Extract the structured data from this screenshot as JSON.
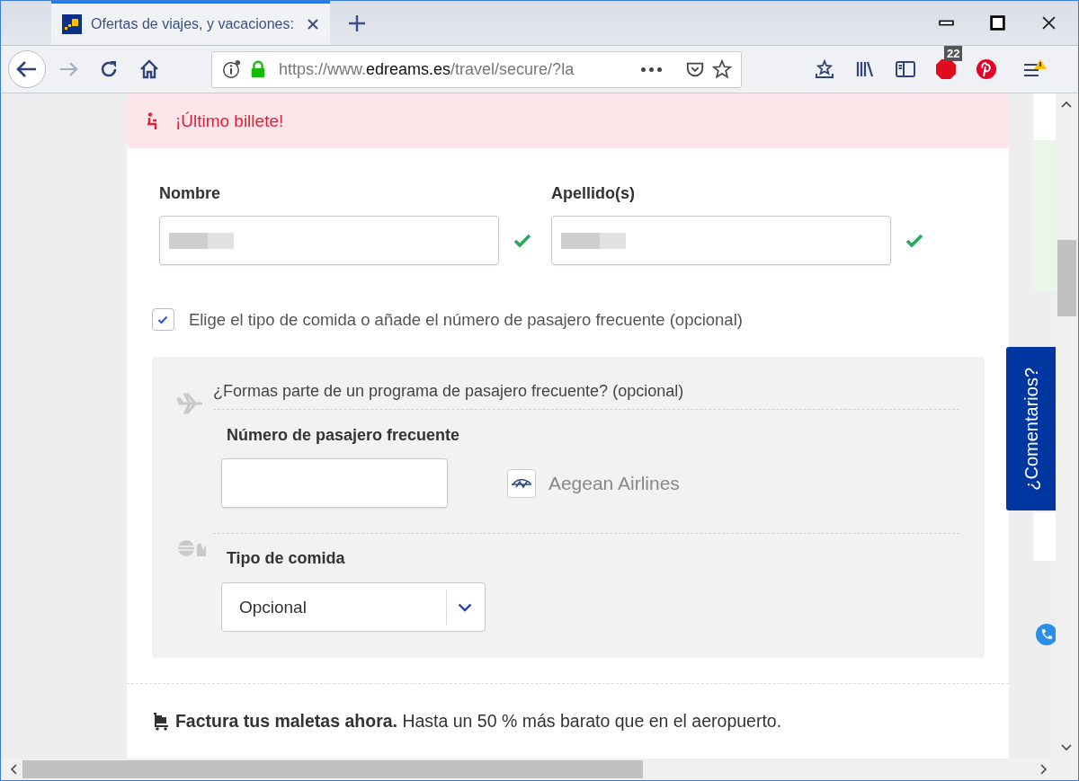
{
  "browser": {
    "tab": {
      "title": "Ofertas de viajes, y vacaciones:",
      "selected": true
    },
    "url": {
      "scheme": "https://www.",
      "domain": "edreams.es",
      "path": "/travel/secure/?la"
    },
    "adblock_badge": "22"
  },
  "alert": {
    "text": "¡Último billete!"
  },
  "name_fields": [
    {
      "label": "Nombre",
      "valid": true
    },
    {
      "label": "Apellido(s)",
      "valid": true
    }
  ],
  "extras_option": {
    "label": "Elige el tipo de comida o añade el número de pasajero frecuente (opcional)",
    "checked": true
  },
  "frequent_flyer": {
    "question": "¿Formas parte de un programa de pasajero frecuente? (opcional)",
    "field_label": "Número de pasajero frecuente",
    "airline": "Aegean Airlines"
  },
  "meal": {
    "label": "Tipo de comida",
    "value": "Opcional"
  },
  "luggage": {
    "text": "**Factura tus maletas ahora.** Hasta un 50 % más barato que en el aeropuerto."
  },
  "feedback_tab": {
    "label": "¿Comentarios?"
  }
}
